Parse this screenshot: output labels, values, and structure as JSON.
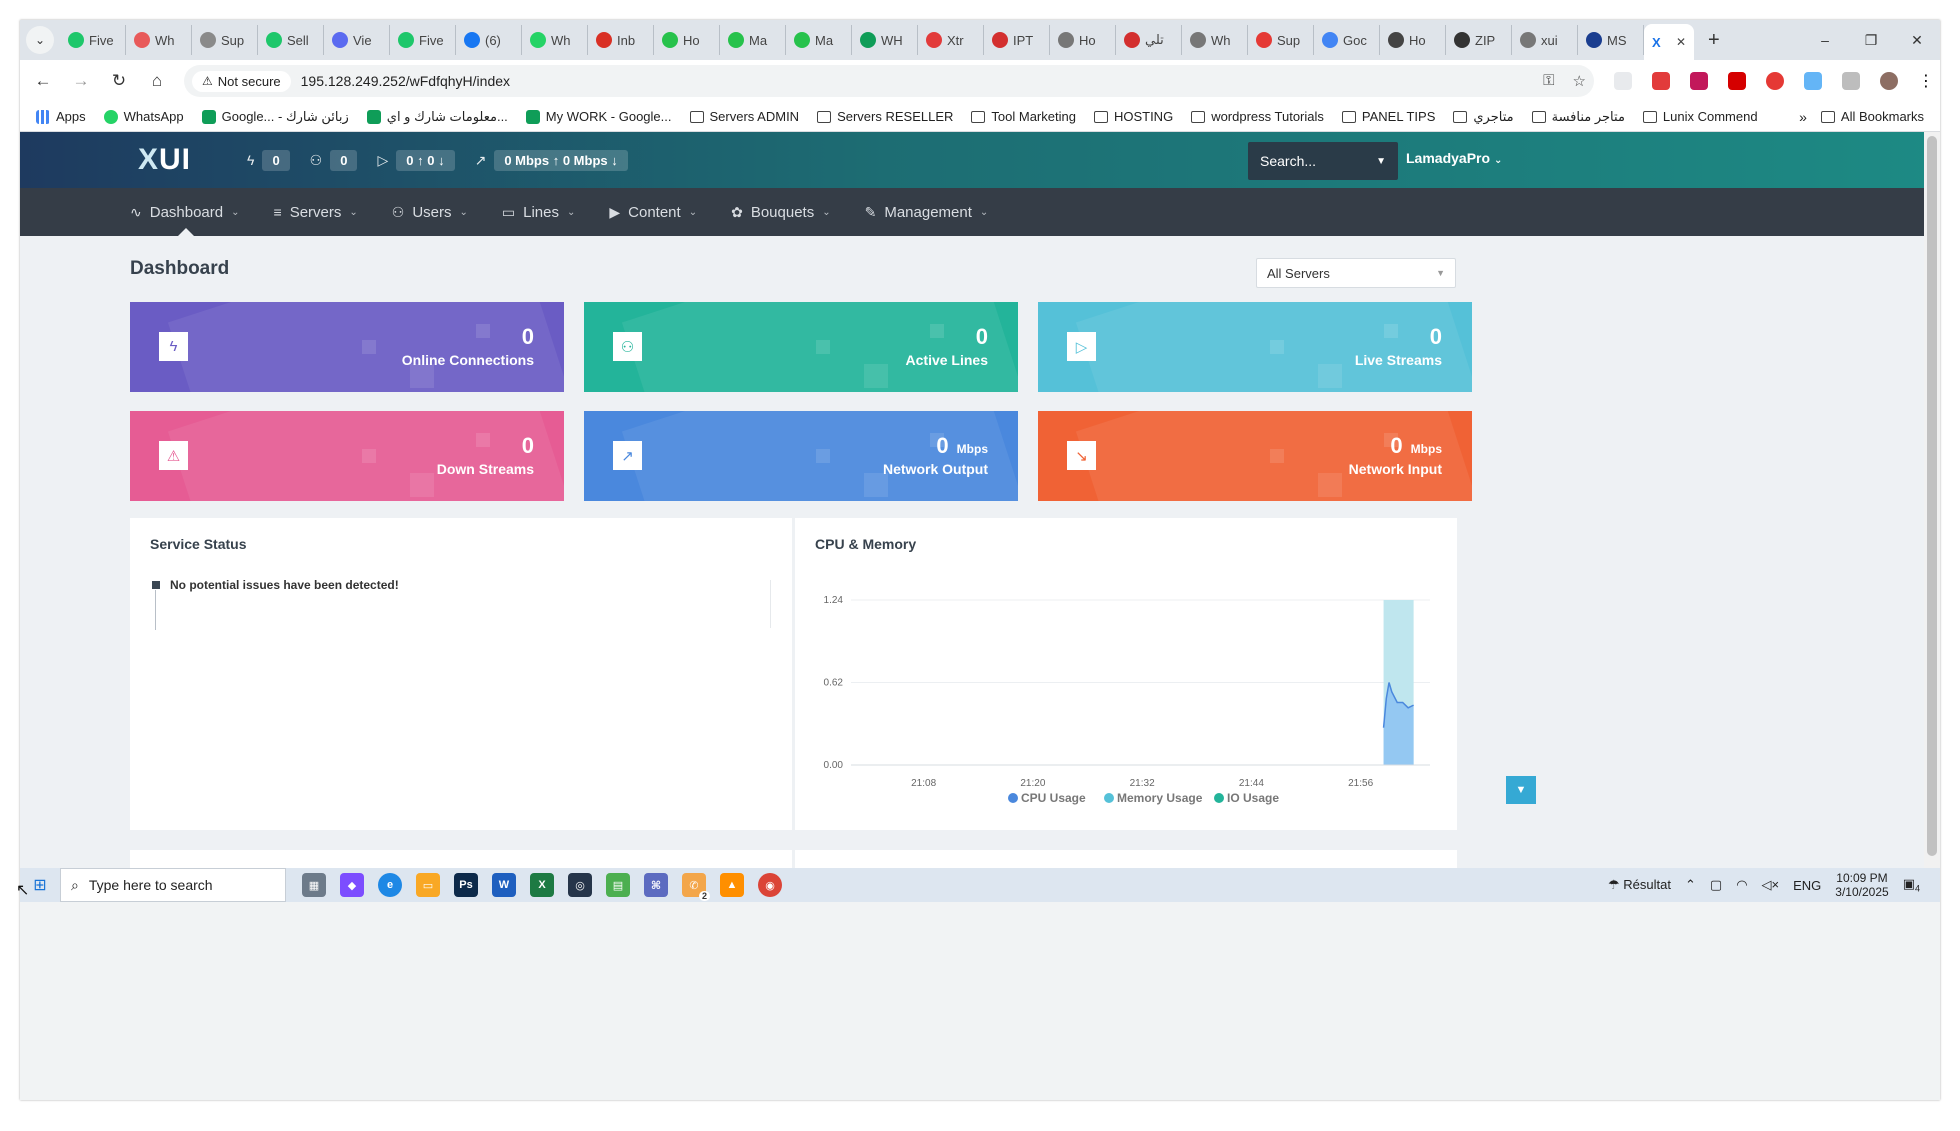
{
  "browser": {
    "tabs": [
      "Five",
      "Wh",
      "Sup",
      "Sell",
      "Vie",
      "Five",
      "(6)",
      "Wh",
      "Inb",
      "Ho",
      "Ma",
      "Ma",
      "WH",
      "Xtr",
      "IPT",
      "Ho",
      "تلي",
      "Wh",
      "Sup",
      "Goc",
      "Ho",
      "ZIP",
      "xui",
      "MS"
    ],
    "active_tab_icon": "X",
    "security_label": "Not secure",
    "url": "195.128.249.252/wFdfqhyH/index",
    "bookmarks": [
      "Apps",
      "WhatsApp",
      "Google... - زبائن شارك",
      "معلومات شارك و اي...",
      "My WORK - Google...",
      "Servers ADMIN",
      "Servers RESELLER",
      "Tool Marketing",
      "HOSTING",
      "wordpress Tutorials",
      "PANEL TIPS",
      "متاجري",
      "متاجر منافسة",
      "Lunix Commend"
    ],
    "all_bookmarks": "All Bookmarks"
  },
  "header": {
    "logo_x": "X",
    "logo_ui": "UI",
    "stat_connections": "0",
    "stat_users": "0",
    "stat_streams_up": "0",
    "stat_streams_down": "0",
    "stat_out": "0 Mbps",
    "stat_in": "0 Mbps",
    "search": "Search...",
    "user": "LamadyaPro"
  },
  "menu": [
    "Dashboard",
    "Servers",
    "Users",
    "Lines",
    "Content",
    "Bouquets",
    "Management"
  ],
  "page": {
    "title": "Dashboard",
    "server_select": "All Servers"
  },
  "cards": [
    {
      "value": "0",
      "unit": "",
      "label": "Online Connections",
      "color": "#6a5cc4"
    },
    {
      "value": "0",
      "unit": "",
      "label": "Active Lines",
      "color": "#23b49a"
    },
    {
      "value": "0",
      "unit": "",
      "label": "Live Streams",
      "color": "#55c1d8"
    },
    {
      "value": "0",
      "unit": "",
      "label": "Down Streams",
      "color": "#e65c94"
    },
    {
      "value": "0",
      "unit": "Mbps",
      "label": "Network Output",
      "color": "#4a88dd"
    },
    {
      "value": "0",
      "unit": "Mbps",
      "label": "Network Input",
      "color": "#f06235"
    }
  ],
  "service_status": {
    "title": "Service Status",
    "message": "No potential issues have been detected!"
  },
  "cpu_memory": {
    "title": "CPU & Memory"
  },
  "chart_data": {
    "type": "area",
    "title": "CPU & Memory",
    "x_ticks": [
      "21:08",
      "21:20",
      "21:32",
      "21:44",
      "21:56"
    ],
    "y_ticks": [
      "0.00",
      "0.62",
      "1.24"
    ],
    "ylim": [
      0,
      1.24
    ],
    "series": [
      {
        "name": "CPU Usage",
        "color": "#4a88dd",
        "points": [
          [
            21.975,
            0.28
          ],
          [
            21.98,
            0.5
          ],
          [
            21.985,
            0.62
          ],
          [
            21.99,
            0.55
          ],
          [
            22.0,
            0.47
          ],
          [
            22.01,
            0.47
          ],
          [
            22.02,
            0.43
          ],
          [
            22.03,
            0.45
          ]
        ]
      },
      {
        "name": "Memory Usage",
        "color": "#55c1d8",
        "points": [
          [
            21.975,
            1.24
          ],
          [
            22.03,
            1.24
          ]
        ]
      },
      {
        "name": "IO Usage",
        "color": "#23b49a",
        "points": []
      }
    ],
    "legend": "bottom",
    "grid": true
  },
  "taskbar": {
    "search": "Type here to search",
    "weather": "Résultat",
    "lang": "ENG",
    "time": "10:09 PM",
    "date": "3/10/2025",
    "notif": "4",
    "whatsapp_badge": "2"
  }
}
